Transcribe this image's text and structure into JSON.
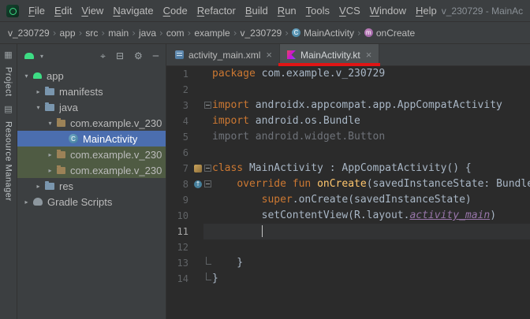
{
  "colors": {
    "panel_bg": "#3c3f41",
    "editor_bg": "#2b2b2b",
    "selection_blue": "#4b6eaf",
    "green_row": "#4f5b43",
    "annotation_red": "#e01515",
    "keyword": "#cc7832",
    "function": "#ffc66d",
    "plain": "#a9b7c6",
    "unused": "#6f737a",
    "resource": "#9876aa",
    "line_number": "#606366",
    "ui_text": "#bbbbbb",
    "current_line": "#323334",
    "android_green": "#3ddc84"
  },
  "window": {
    "title": "v_230729 - MainAc"
  },
  "menu": {
    "items": [
      "File",
      "Edit",
      "View",
      "Navigate",
      "Code",
      "Refactor",
      "Build",
      "Run",
      "Tools",
      "VCS",
      "Window",
      "Help"
    ]
  },
  "breadcrumbs": {
    "separator": "›",
    "items": [
      {
        "label": "v_230729"
      },
      {
        "label": "app"
      },
      {
        "label": "src"
      },
      {
        "label": "main"
      },
      {
        "label": "java"
      },
      {
        "label": "com"
      },
      {
        "label": "example"
      },
      {
        "label": "v_230729"
      },
      {
        "label": "MainActivity",
        "icon": "kotlin-class-icon"
      },
      {
        "label": "onCreate",
        "icon": "method-icon"
      }
    ]
  },
  "icon_glyphs": {
    "kotlin-class-icon": "C",
    "method-icon": "m",
    "override-gutter-icon": "↑"
  },
  "tool_strip": {
    "items": [
      {
        "type": "icon",
        "name": "project-window-icon",
        "glyph": "▦"
      },
      {
        "type": "label",
        "name": "project-strip-label",
        "text": "Project"
      },
      {
        "type": "icon",
        "name": "bookmarks-icon",
        "glyph": "▤"
      },
      {
        "type": "label",
        "name": "resource-manager-strip-label",
        "text": "Resource Manager"
      }
    ]
  },
  "project_panel": {
    "toolbar": {
      "left_icons": [
        {
          "name": "android-view-icon",
          "type": "android"
        },
        {
          "name": "chevron-down-icon",
          "glyph": "▾"
        }
      ],
      "right_icons": [
        {
          "name": "locate-file-icon",
          "glyph": "⌖"
        },
        {
          "name": "collapse-all-icon",
          "glyph": "⊟"
        },
        {
          "name": "settings-gear-icon",
          "glyph": "⚙"
        },
        {
          "name": "hide-panel-icon",
          "glyph": "─"
        }
      ]
    },
    "tree": [
      {
        "label": "app",
        "level": 0,
        "chevron": "expanded",
        "icon": "android"
      },
      {
        "label": "manifests",
        "level": 1,
        "chevron": "collapsed",
        "icon": "folder"
      },
      {
        "label": "java",
        "level": 1,
        "chevron": "expanded",
        "icon": "folder"
      },
      {
        "label": "com.example.v_230",
        "level": 2,
        "chevron": "expanded",
        "icon": "package"
      },
      {
        "label": "MainActivity",
        "level": 3,
        "chevron": "none",
        "icon": "kotlin-class",
        "state": "selected"
      },
      {
        "label": "com.example.v_230",
        "level": 2,
        "chevron": "collapsed",
        "icon": "package",
        "state": "green"
      },
      {
        "label": "com.example.v_230",
        "level": 2,
        "chevron": "collapsed",
        "icon": "package",
        "state": "green"
      },
      {
        "label": "res",
        "level": 1,
        "chevron": "collapsed",
        "icon": "folder"
      },
      {
        "label": "Gradle Scripts",
        "level": 0,
        "chevron": "collapsed",
        "icon": "gradle"
      }
    ]
  },
  "editor": {
    "tabs": [
      {
        "label": "activity_main.xml",
        "icon": "xml-file-icon",
        "close": "×",
        "active": false
      },
      {
        "label": "MainActivity.kt",
        "icon": "kotlin-file-icon",
        "close": "×",
        "active": true,
        "annotation": "red-underline"
      }
    ],
    "caret": {
      "line": 11,
      "col": 8
    },
    "lines": [
      {
        "n": 1,
        "t": [
          [
            "kw",
            "package"
          ],
          [
            "pl",
            " com.example.v_230729"
          ]
        ]
      },
      {
        "n": 2,
        "t": []
      },
      {
        "n": 3,
        "t": [
          [
            "kw",
            "import"
          ],
          [
            "pl",
            " androidx.appcompat.app.AppCompatActivity"
          ]
        ],
        "fold": "box"
      },
      {
        "n": 4,
        "t": [
          [
            "kw",
            "import"
          ],
          [
            "pl",
            " android.os.Bundle"
          ]
        ]
      },
      {
        "n": 5,
        "t": [
          [
            "gr",
            "import android.widget.Button"
          ]
        ]
      },
      {
        "n": 6,
        "t": []
      },
      {
        "n": 7,
        "t": [
          [
            "kw",
            "class"
          ],
          [
            "pl",
            " MainActivity : AppCompatActivity() {"
          ]
        ],
        "gutter": "class",
        "fold": "box"
      },
      {
        "n": 8,
        "t": [
          [
            "pl",
            "    "
          ],
          [
            "kw",
            "override"
          ],
          [
            "pl",
            " "
          ],
          [
            "kw",
            "fun"
          ],
          [
            "pl",
            " "
          ],
          [
            "fn",
            "onCreate"
          ],
          [
            "pl",
            "(savedInstanceState: Bundle?) {"
          ]
        ],
        "gutter": "override",
        "fold": "box"
      },
      {
        "n": 9,
        "t": [
          [
            "pl",
            "        "
          ],
          [
            "kw",
            "super"
          ],
          [
            "pl",
            ".onCreate(savedInstanceState)"
          ]
        ]
      },
      {
        "n": 10,
        "t": [
          [
            "pl",
            "        setContentView(R.layout."
          ],
          [
            "res",
            "activity_main"
          ],
          [
            "pl",
            ")"
          ]
        ]
      },
      {
        "n": 11,
        "t": []
      },
      {
        "n": 12,
        "t": []
      },
      {
        "n": 13,
        "t": [
          [
            "pl",
            "    }"
          ]
        ],
        "fold": "end"
      },
      {
        "n": 14,
        "t": [
          [
            "pl",
            "}"
          ]
        ],
        "fold": "end"
      }
    ]
  }
}
